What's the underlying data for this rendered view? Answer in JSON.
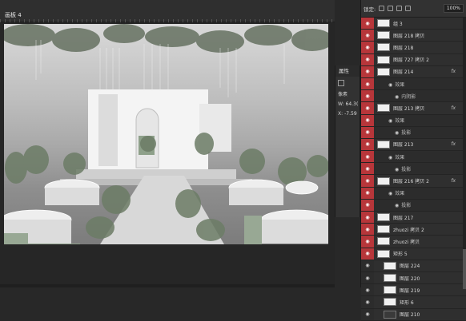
{
  "canvas": {
    "artboard_label": "画板 4"
  },
  "properties_panel": {
    "title": "属性",
    "tab_label": "像素",
    "w_label": "W:",
    "w_value": "64.3(",
    "x_label": "X:",
    "x_value": "-7.59"
  },
  "layers_panel": {
    "lock_label": "锁定:",
    "fill_value": "100%",
    "rows": [
      {
        "name": "组 3",
        "type": "group"
      },
      {
        "name": "图层 218 拷贝",
        "type": "layer"
      },
      {
        "name": "图层 218",
        "type": "layer"
      },
      {
        "name": "图层 727 拷贝 2",
        "type": "layer"
      },
      {
        "name": "图层 214",
        "type": "layer",
        "fx": "fx"
      },
      {
        "name": "效果",
        "type": "effect"
      },
      {
        "name": "内阴影",
        "type": "sub"
      },
      {
        "name": "图层 213 拷贝",
        "type": "layer",
        "fx": "fx"
      },
      {
        "name": "效果",
        "type": "effect"
      },
      {
        "name": "投影",
        "type": "sub"
      },
      {
        "name": "图层 213",
        "type": "layer",
        "fx": "fx"
      },
      {
        "name": "效果",
        "type": "effect"
      },
      {
        "name": "投影",
        "type": "sub"
      },
      {
        "name": "图层 216 拷贝 2",
        "type": "layer",
        "fx": "fx"
      },
      {
        "name": "效果",
        "type": "effect"
      },
      {
        "name": "投影",
        "type": "sub"
      },
      {
        "name": "图层 217",
        "type": "layer"
      },
      {
        "name": "zhuozi 拷贝 2",
        "type": "layer"
      },
      {
        "name": "zhuozi 拷贝",
        "type": "layer"
      },
      {
        "name": "矩形 5",
        "type": "layer"
      },
      {
        "name": "图层 224",
        "type": "plain"
      },
      {
        "name": "图层 220",
        "type": "plain"
      },
      {
        "name": "图层 219",
        "type": "plain"
      },
      {
        "name": "矩形 6",
        "type": "plain"
      },
      {
        "name": "图层 210",
        "type": "plain-dark"
      }
    ]
  },
  "colors": {
    "visibility_column": "#b7363a",
    "panel_bg": "#2b2b2b",
    "canvas_bg": "#262626"
  }
}
